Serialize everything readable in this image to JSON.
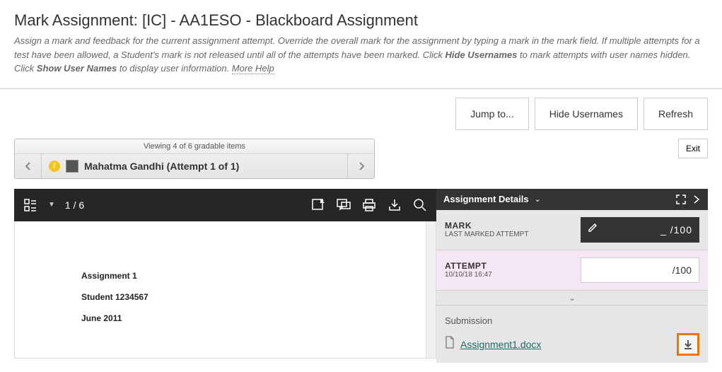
{
  "header": {
    "title": "Mark Assignment: [IC] - AA1ESO - Blackboard Assignment",
    "desc_1": "Assign a mark and feedback for the current assignment attempt. Override the overall mark for the assignment by typing a mark in the mark field. If multiple attempts for a test have been allowed, a Student's mark is not released until all of the attempts have been marked. Click ",
    "desc_b1": "Hide Usernames",
    "desc_2": " to mark attempts with user names hidden. Click ",
    "desc_b2": "Show User Names",
    "desc_3": " to display user information. ",
    "more_help": "More Help"
  },
  "actions": {
    "jump": "Jump to...",
    "hide": "Hide Usernames",
    "refresh": "Refresh"
  },
  "pager": {
    "header": "Viewing 4 of 6 gradable items",
    "student": "Mahatma Gandhi (Attempt 1 of 1)"
  },
  "exit": "Exit",
  "doc": {
    "page_info": "1 / 6",
    "lines": {
      "l1": "Assignment 1",
      "l2": "Student 1234567",
      "l3": "June 2011"
    }
  },
  "side": {
    "title": "Assignment Details",
    "mark_label": "MARK",
    "mark_sub": "LAST MARKED ATTEMPT",
    "mark_value": "_ /100",
    "attempt_label": "ATTEMPT",
    "attempt_time": "10/10/18 16:47",
    "attempt_value": "/100",
    "submission_title": "Submission",
    "file_name": "Assignment1.docx"
  }
}
